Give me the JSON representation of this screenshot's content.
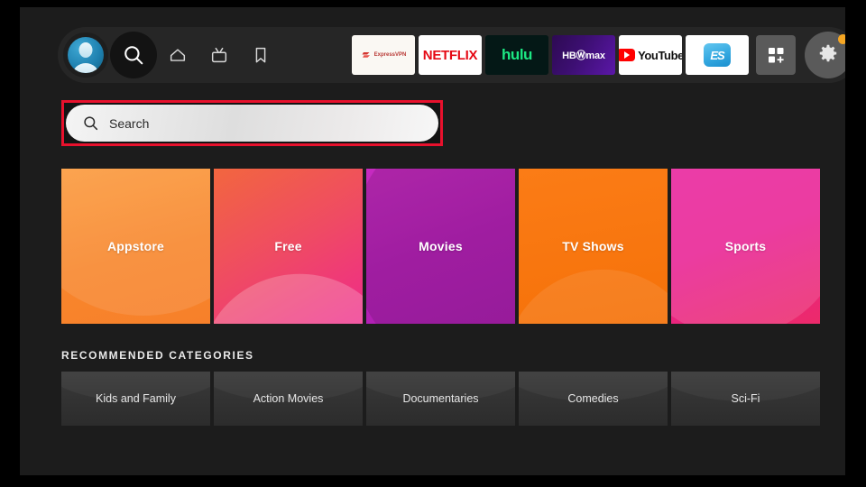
{
  "nav": {
    "avatar": {
      "name": "profile-avatar"
    },
    "buttons": [
      {
        "id": "search",
        "icon": "search-icon",
        "label": "Search"
      },
      {
        "id": "home",
        "icon": "home-icon",
        "label": "Home"
      },
      {
        "id": "live",
        "icon": "tv-icon",
        "label": "Live TV"
      },
      {
        "id": "bookmark",
        "icon": "bookmark-icon",
        "label": "Bookmarks"
      }
    ],
    "apps": [
      {
        "id": "expressvpn",
        "name": "ExpressVPN",
        "wordmark": "ExpressVPN",
        "bg": "#faf8f3",
        "fg": "#b93a36"
      },
      {
        "id": "netflix",
        "name": "Netflix",
        "wordmark": "NETFLIX",
        "bg": "#ffffff",
        "fg": "#e50914"
      },
      {
        "id": "hulu",
        "name": "Hulu",
        "wordmark": "hulu",
        "bg": "#041816",
        "fg": "#1ce783"
      },
      {
        "id": "hbomax",
        "name": "HBO Max",
        "wordmark": "HBⓌmax",
        "bg": "#3d0f73",
        "fg": "#ffffff"
      },
      {
        "id": "youtube",
        "name": "YouTube",
        "wordmark": "YouTube",
        "bg": "#ffffff",
        "fg": "#0f0f0f"
      },
      {
        "id": "esfile",
        "name": "ES File Explorer",
        "wordmark": "ES",
        "bg": "#ffffff",
        "fg": "#34a8e0"
      }
    ],
    "apps_grid_button": {
      "icon": "apps-grid-plus-icon",
      "label": "All Apps"
    },
    "settings_button": {
      "icon": "gear-icon",
      "label": "Settings",
      "badge": true,
      "badge_color": "#f5a623"
    }
  },
  "search": {
    "placeholder": "Search",
    "icon": "search-icon",
    "highlight_color": "#e8112d"
  },
  "tiles": [
    {
      "label": "Appstore",
      "accent": "#f8862c"
    },
    {
      "label": "Free",
      "accent": "#ef4b63"
    },
    {
      "label": "Movies",
      "accent": "#b521b7"
    },
    {
      "label": "TV Shows",
      "accent": "#f8760f"
    },
    {
      "label": "Sports",
      "accent": "#e81f93"
    }
  ],
  "recommended": {
    "heading": "RECOMMENDED CATEGORIES",
    "items": [
      {
        "label": "Kids and Family"
      },
      {
        "label": "Action Movies"
      },
      {
        "label": "Documentaries"
      },
      {
        "label": "Comedies"
      },
      {
        "label": "Sci-Fi"
      }
    ]
  }
}
